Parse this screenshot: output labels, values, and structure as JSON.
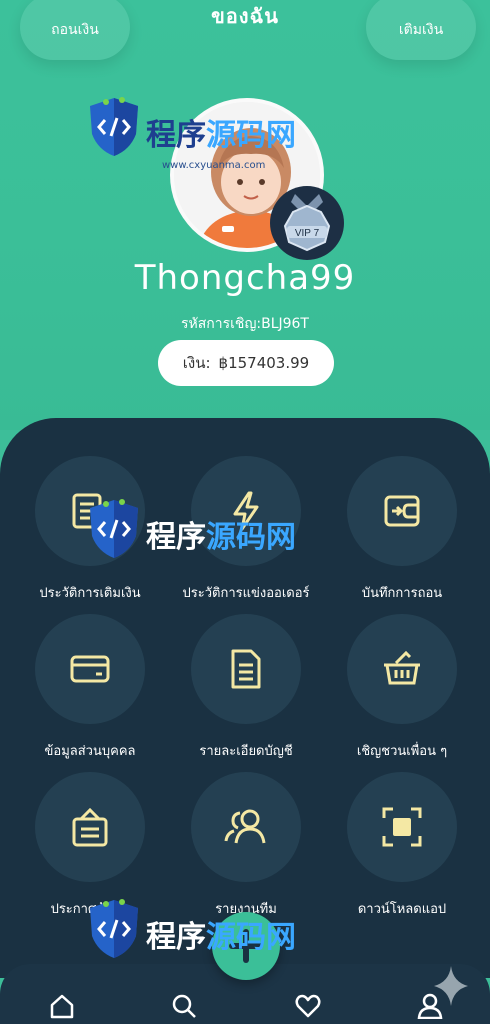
{
  "header": {
    "title": "ของฉัน",
    "withdraw_label": "ถอนเงิน",
    "deposit_label": "เติมเงิน"
  },
  "profile": {
    "username": "Thongcha99",
    "invite_code": "รหัสการเชิญ:BLJ96T",
    "balance_label": "เงิน:",
    "balance_value": "฿157403.99",
    "vip_level": "VIP 7"
  },
  "menu": [
    {
      "label": "ประวัติการเติมเงิน",
      "icon": "document-list-icon"
    },
    {
      "label": "ประวัติการแข่งออเดอร์",
      "icon": "lightning-icon"
    },
    {
      "label": "บันทึกการถอน",
      "icon": "wallet-icon"
    },
    {
      "label": "ข้อมูลส่วนบุคคล",
      "icon": "card-icon"
    },
    {
      "label": "รายละเอียดบัญชี",
      "icon": "file-text-icon"
    },
    {
      "label": "เชิญชวนเพื่อน ๆ",
      "icon": "basket-icon"
    },
    {
      "label": "ประกาศข้อมูล",
      "icon": "announcement-icon"
    },
    {
      "label": "รายงานทีม",
      "icon": "team-icon"
    },
    {
      "label": "ดาวน์โหลดแอป",
      "icon": "download-scan-icon"
    }
  ],
  "bottom_nav": [
    "home-icon",
    "search-icon",
    "heart-icon",
    "user-icon"
  ],
  "watermark": {
    "text": "程序源码网",
    "url": "www.cxyuanma.com"
  },
  "colors": {
    "brand_green": "#3bbf98",
    "panel_dark": "#1a3142",
    "circle_dark": "#244052",
    "icon_yellow": "#f4e8a4"
  }
}
